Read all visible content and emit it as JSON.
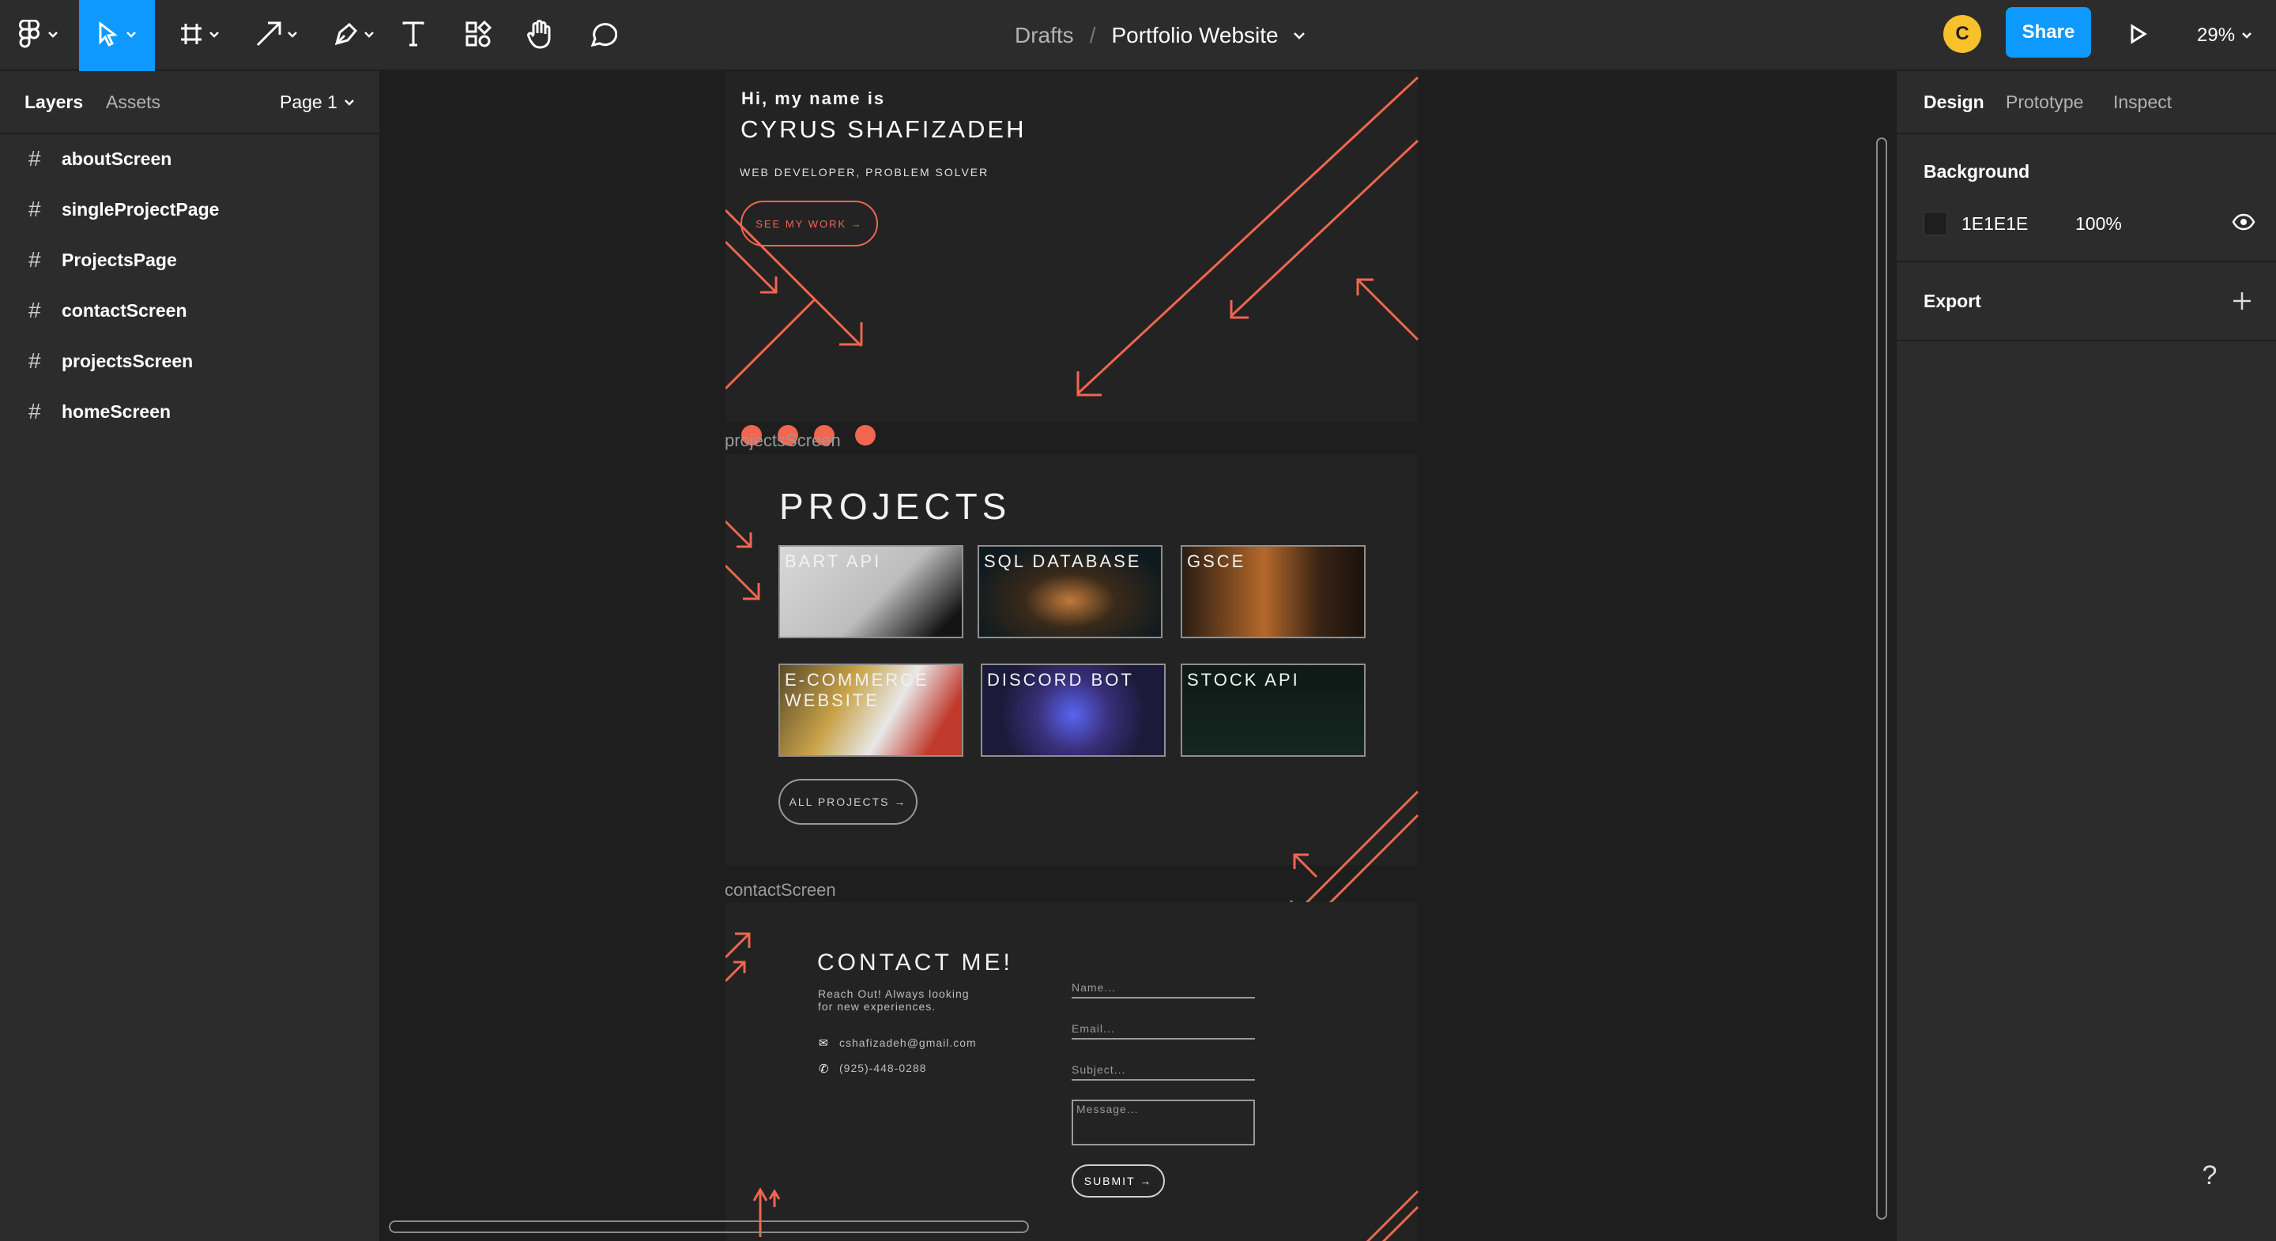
{
  "toolbar": {
    "breadcrumb_drafts": "Drafts",
    "breadcrumb_sep": "/",
    "file_name": "Portfolio Website",
    "avatar_initial": "C",
    "share_label": "Share",
    "zoom_level": "29%",
    "tools": [
      "main-menu-icon",
      "move-tool-icon",
      "frame-tool-icon",
      "shape-tool-icon",
      "pen-tool-icon",
      "text-tool-icon",
      "resources-icon",
      "hand-tool-icon",
      "comment-tool-icon",
      "present-icon"
    ],
    "accent_color": "#0d99ff"
  },
  "left_panel": {
    "tabs": [
      {
        "label": "Layers"
      },
      {
        "label": "Assets"
      }
    ],
    "page_selector": "Page 1",
    "layers": [
      {
        "name": "aboutScreen"
      },
      {
        "name": "singleProjectPage"
      },
      {
        "name": "ProjectsPage"
      },
      {
        "name": "contactScreen"
      },
      {
        "name": "projectsScreen"
      },
      {
        "name": "homeScreen"
      }
    ]
  },
  "canvas": {
    "hero": {
      "greeting": "Hi, my name is",
      "name": "CYRUS SHAFIZADEH",
      "tagline": "WEB DEVELOPER, PROBLEM SOLVER",
      "cta": "SEE MY WORK →",
      "accent_color": "#f0664e"
    },
    "projects_frame_label": "projectsScreen",
    "projects": {
      "title": "PROJECTS",
      "cards": [
        {
          "label": "BART API"
        },
        {
          "label": "SQL DATABASE"
        },
        {
          "label": "GSCE"
        },
        {
          "label": "E-COMMERCE WEBSITE"
        },
        {
          "label": "DISCORD BOT"
        },
        {
          "label": "STOCK API"
        }
      ],
      "all_projects": "ALL PROJECTS →"
    },
    "contact_frame_label": "contactScreen",
    "contact": {
      "title": "CONTACT ME!",
      "subtitle": "Reach Out! Always looking for new experiences.",
      "email": "cshafizadeh@gmail.com",
      "phone": "(925)-448-0288",
      "fields": {
        "name": "Name...",
        "email": "Email...",
        "subject": "Subject...",
        "message": "Message..."
      },
      "submit": "SUBMIT →"
    },
    "social_icons": [
      "instagram-icon",
      "linkedin-icon",
      "github-icon",
      "youtube-icon"
    ]
  },
  "right_panel": {
    "tabs": [
      {
        "label": "Design"
      },
      {
        "label": "Prototype"
      },
      {
        "label": "Inspect"
      }
    ],
    "background": {
      "title": "Background",
      "hex": "1E1E1E",
      "opacity": "100%",
      "swatch_color": "#1e1e1e"
    },
    "export": {
      "title": "Export"
    },
    "help": "?"
  }
}
